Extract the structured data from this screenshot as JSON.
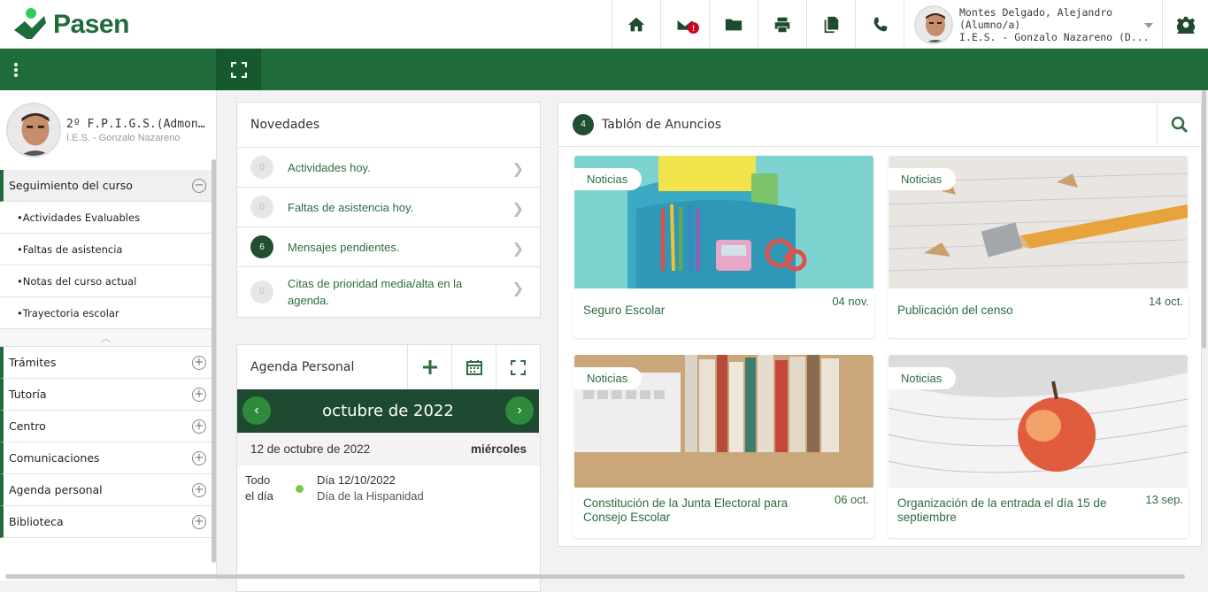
{
  "app": {
    "name": "Pasen",
    "brand_color": "#1f6b3a"
  },
  "topbar": {
    "icons": [
      "home-icon",
      "mail-icon",
      "folder-icon",
      "print-icon",
      "documents-icon",
      "phone-icon"
    ],
    "mail_badge": "!",
    "user": {
      "name": "Montes Delgado, Alejandro",
      "role": "(Alumno/a)",
      "school": "I.E.S. - Gonzalo Nazareno (D..."
    }
  },
  "sidebar": {
    "profile": {
      "course": "2º F.P.I.G.S.(Admon...",
      "school": "I.E.S. - Gonzalo Nazareno"
    },
    "section_open": "Seguimiento del curso",
    "subitems": [
      "•Actividades Evaluables",
      "•Faltas de asistencia",
      "•Notas del curso actual",
      "•Trayectoria escolar"
    ],
    "categories": [
      "Trámites",
      "Tutoría",
      "Centro",
      "Comunicaciones",
      "Agenda personal",
      "Biblioteca"
    ]
  },
  "novedades": {
    "title": "Novedades",
    "items": [
      {
        "count": "0",
        "label": "Actividades hoy.",
        "active": false
      },
      {
        "count": "0",
        "label": "Faltas de asistencia hoy.",
        "active": false
      },
      {
        "count": "6",
        "label": "Mensajes pendientes.",
        "active": true
      },
      {
        "count": "0",
        "label": "Citas de prioridad media/alta en la agenda.",
        "active": false
      }
    ]
  },
  "agenda": {
    "title": "Agenda Personal",
    "month": "octubre de 2022",
    "date": "12 de octubre de 2022",
    "weekday": "miércoles",
    "event": {
      "time": "Todo el día",
      "day": "Día 12/10/2022",
      "desc": "Día de la Hispanidad"
    }
  },
  "tablon": {
    "count": "4",
    "title": "Tablón de Anuncios",
    "cards": [
      {
        "tag": "Noticias",
        "title": "Seguro Escolar",
        "date": "04 nov."
      },
      {
        "tag": "Noticias",
        "title": "Publicación del censo",
        "date": "14 oct."
      },
      {
        "tag": "Noticias",
        "title": "Constitución de la Junta Electoral para Consejo Escolar",
        "date": "06 oct."
      },
      {
        "tag": "Noticias",
        "title": "Organización de la entrada el día 15 de septiembre",
        "date": "13 sep."
      }
    ]
  }
}
